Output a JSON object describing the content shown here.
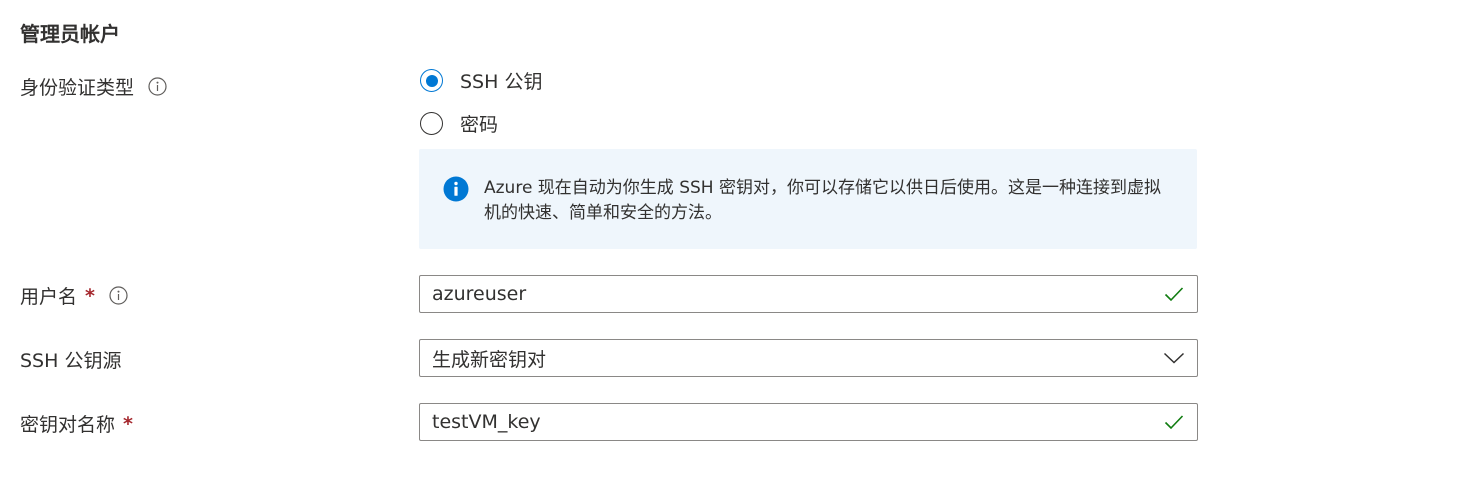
{
  "section": {
    "title": "管理员帐户"
  },
  "auth_type": {
    "label": "身份验证类型",
    "options": [
      {
        "label": "SSH 公钥",
        "checked": true
      },
      {
        "label": "密码",
        "checked": false
      }
    ]
  },
  "info_box": {
    "text": "Azure 现在自动为你生成 SSH 密钥对，你可以存储它以供日后使用。这是一种连接到虚拟机的快速、简单和安全的方法。"
  },
  "username": {
    "label": "用户名",
    "required_mark": "*",
    "value": "azureuser"
  },
  "ssh_key_source": {
    "label": "SSH 公钥源",
    "selected": "生成新密钥对"
  },
  "key_pair_name": {
    "label": "密钥对名称",
    "required_mark": "*",
    "value": "testVM_key"
  },
  "icons": {
    "info": "info-circle-icon",
    "info_filled": "info-filled-icon",
    "check": "checkmark-icon",
    "chevron": "chevron-down-icon"
  },
  "colors": {
    "accent": "#0078d4",
    "required": "#a4262c",
    "valid": "#107c10",
    "info_bg": "#eff6fc"
  }
}
